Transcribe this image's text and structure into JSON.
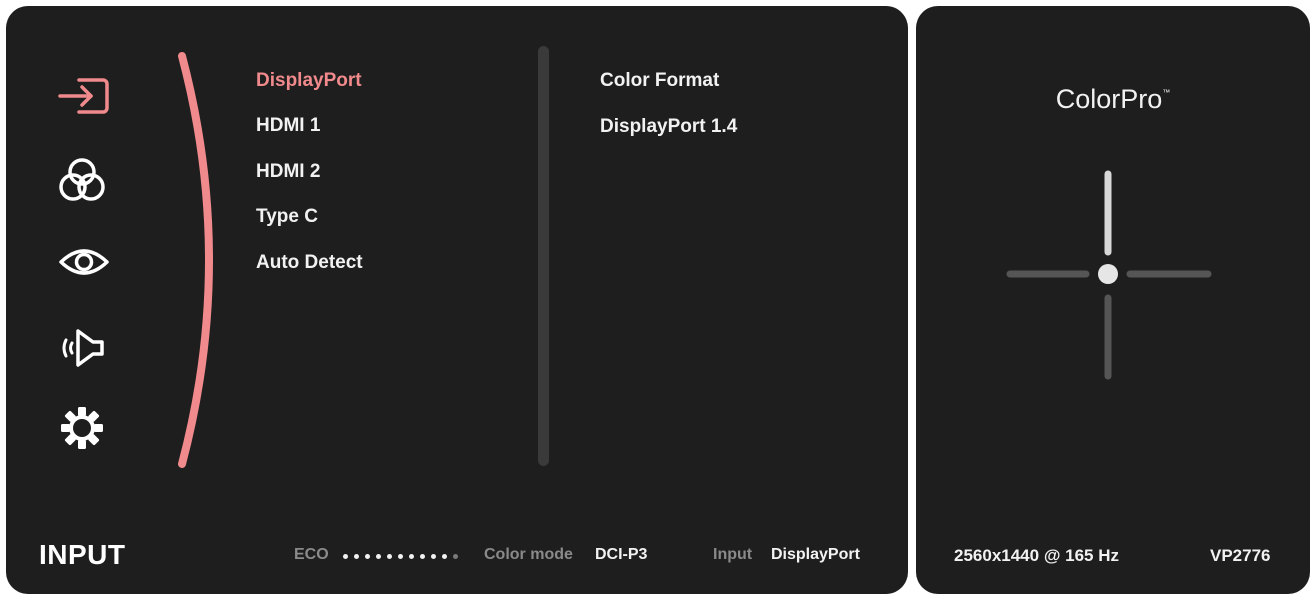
{
  "sidebar": {
    "icons": [
      {
        "name": "input-icon",
        "active": true
      },
      {
        "name": "color-adjust-icon",
        "active": false
      },
      {
        "name": "eye-view-icon",
        "active": false
      },
      {
        "name": "audio-icon",
        "active": false
      },
      {
        "name": "setup-gear-icon",
        "active": false
      }
    ]
  },
  "menu": {
    "items": [
      {
        "label": "DisplayPort",
        "selected": true
      },
      {
        "label": "HDMI 1",
        "selected": false
      },
      {
        "label": "HDMI 2",
        "selected": false
      },
      {
        "label": "Type C",
        "selected": false
      },
      {
        "label": "Auto Detect",
        "selected": false
      }
    ]
  },
  "submenu": {
    "title": "Color Format",
    "value": "DisplayPort 1.4"
  },
  "footer": {
    "title": "INPUT",
    "eco_label": "ECO",
    "eco_level": 10,
    "eco_max": 11,
    "color_mode_label": "Color mode",
    "color_mode_value": "DCI-P3",
    "input_label": "Input",
    "input_value": "DisplayPort"
  },
  "info": {
    "brand": "ColorPro",
    "trademark": "™",
    "resolution": "2560x1440 @ 165 Hz",
    "model": "VP2776"
  },
  "colors": {
    "accent": "#f08a8c",
    "panel": "#1e1e1e",
    "text": "#f2f2f2",
    "muted": "#8a8a8a"
  }
}
